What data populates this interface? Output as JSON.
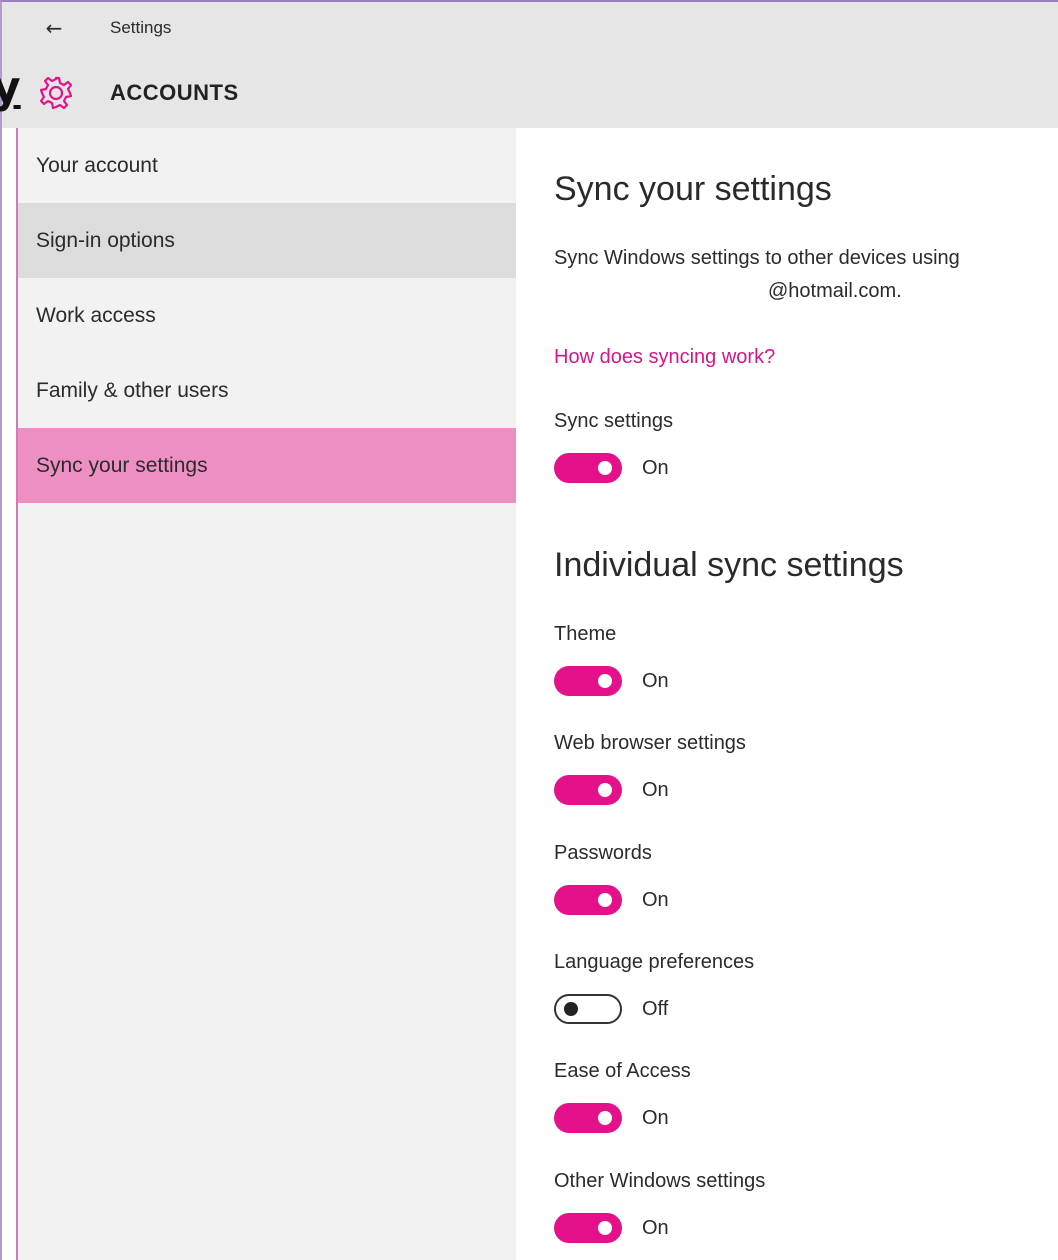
{
  "titlebar": {
    "back_icon": "arrow-left-icon",
    "title": "Settings"
  },
  "header": {
    "overlay_glyph": "y",
    "icon": "gear-icon",
    "section_title": "ACCOUNTS"
  },
  "sidebar": {
    "items": [
      {
        "label": "Your account"
      },
      {
        "label": "Sign-in options"
      },
      {
        "label": "Work access"
      },
      {
        "label": "Family & other users"
      },
      {
        "label": "Sync your settings"
      }
    ]
  },
  "content": {
    "title": "Sync your settings",
    "description_line1": "Sync Windows settings to other devices using",
    "description_line2": "@hotmail.com.",
    "help_link": "How does syncing work?",
    "sync_settings": {
      "label": "Sync settings",
      "state": "On"
    },
    "individual_title": "Individual sync settings",
    "individual": [
      {
        "label": "Theme",
        "state": "On"
      },
      {
        "label": "Web browser settings",
        "state": "On"
      },
      {
        "label": "Passwords",
        "state": "On"
      },
      {
        "label": "Language preferences",
        "state": "Off"
      },
      {
        "label": "Ease of Access",
        "state": "On"
      },
      {
        "label": "Other Windows settings",
        "state": "On"
      }
    ]
  },
  "colors": {
    "accent": "#e5118a",
    "selected_nav": "#ee8fc4",
    "link": "#d6158a",
    "chrome": "#e6e6e6",
    "sidebar": "#f2f2f2"
  }
}
